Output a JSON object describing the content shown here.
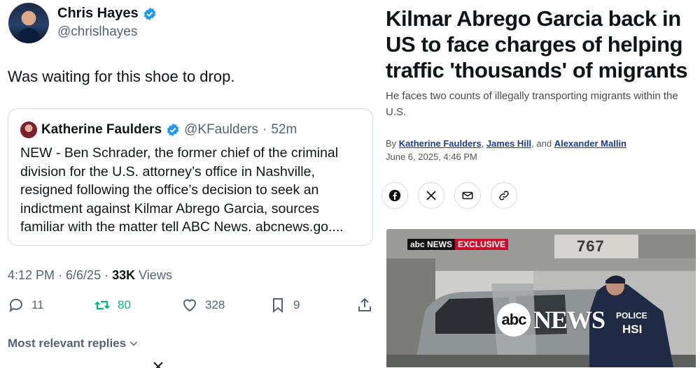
{
  "tweet": {
    "author": {
      "name": "Chris Hayes",
      "handle": "@chrislhayes"
    },
    "text": "Was waiting for this shoe to drop.",
    "quote": {
      "name": "Katherine Faulders",
      "handle": "@KFaulders",
      "time": "52m",
      "text": "NEW - Ben Schrader, the former chief of the criminal division for the U.S. attorney’s office in Nashville, resigned following the office’s decision to seek an indictment against Kilmar Abrego Garcia, sources familiar with the matter tell ABC News. abcnews.go...."
    },
    "timestamp": "4:12 PM · 6/6/25 · ",
    "views_count": "33K",
    "views_label": "Views",
    "stats": {
      "replies": "11",
      "reposts": "80",
      "likes": "328",
      "bookmarks": "9"
    },
    "replies_filter": "Most relevant replies",
    "colors": {
      "verified": "#1d9bf0",
      "repost": "#00ba7c",
      "muted": "#536471"
    }
  },
  "article": {
    "headline": "Kilmar Abrego Garcia back in US to face charges of helping traffic 'thousands' of migrants",
    "dek": "He faces two counts of illegally transporting migrants within the U.S.",
    "byline": {
      "prefix": "By",
      "authors": [
        "Katherine Faulders",
        "James Hill",
        "Alexander Mallin"
      ],
      "sep1": ",",
      "sep2": ", and"
    },
    "date": "June 6, 2025, 4:46 PM",
    "share_icons": [
      "facebook-icon",
      "x-icon",
      "mail-icon",
      "link-icon"
    ],
    "photo": {
      "bug_network": "abc NEWS",
      "bug_label": "EXCLUSIVE",
      "sign": "767",
      "logo_abc": "abc",
      "logo_news": "NEWS",
      "vest_top": "POLICE",
      "vest_bottom": "HSI"
    }
  }
}
